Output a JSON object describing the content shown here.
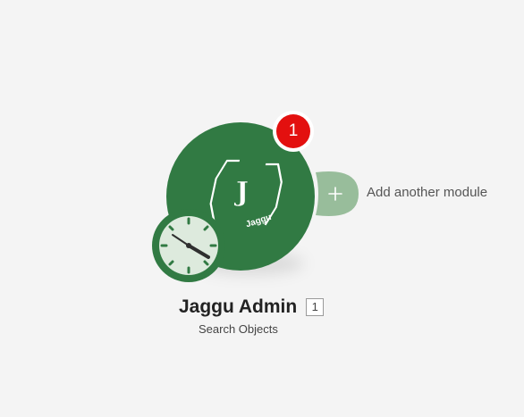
{
  "module": {
    "name": "Jaggu Admin",
    "action": "Search Objects",
    "count": "1",
    "notification_count": "1",
    "logo_letter": "J",
    "logo_text": "Jaggu",
    "logo_icon": "jaggu-logo-icon"
  },
  "add_module": {
    "label": "Add another module",
    "icon": "plus-icon"
  },
  "trigger": {
    "icon": "clock-icon"
  },
  "colors": {
    "module_green": "#317a43",
    "add_green": "#98bd9b",
    "badge_red": "#e3100f",
    "background": "#f4f4f4"
  }
}
